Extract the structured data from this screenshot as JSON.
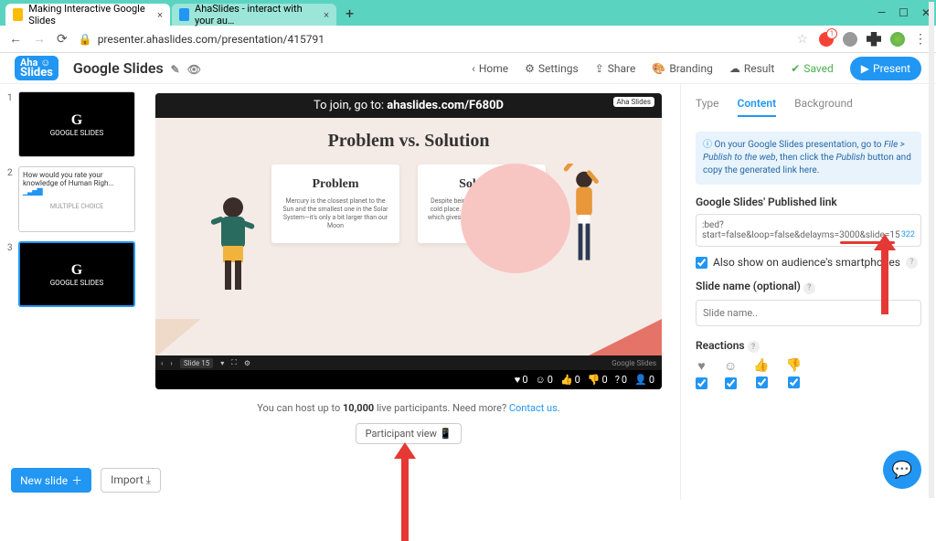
{
  "browser": {
    "tabs": [
      {
        "title": "Making Interactive Google Slides"
      },
      {
        "title": "AhaSlides - interact with your au…"
      }
    ],
    "url": "presenter.ahaslides.com/presentation/415791"
  },
  "app": {
    "logo_top": "Aha ☺",
    "logo_bot": "Slides",
    "doc_title": "Google Slides",
    "nav": {
      "home": "Home",
      "settings": "Settings",
      "share": "Share",
      "branding": "Branding",
      "result": "Result",
      "saved": "Saved",
      "present": "Present"
    }
  },
  "thumbs": [
    {
      "n": "1",
      "kind": "black",
      "line1": "G",
      "line2": "GOOGLE SLIDES"
    },
    {
      "n": "2",
      "kind": "white",
      "q": "How would you rate your knowledge of Human Righ...",
      "type": "MULTIPLE CHOICE"
    },
    {
      "n": "3",
      "kind": "black",
      "line1": "G",
      "line2": "GOOGLE SLIDES"
    }
  ],
  "slide": {
    "join_prefix": "To join, go to: ",
    "join_url": "ahaslides.com/F680D",
    "aha_badge": "Aha Slides",
    "title": "Problem vs. Solution",
    "problem_h": "Problem",
    "problem_p": "Mercury is the closest planet to the Sun and the smallest one in the Solar System—it's only a bit larger than our Moon",
    "solution_h": "Solution",
    "solution_p": "Despite being red, Mars is actually a cold place. It's full of iron oxide dust, which gives the planet its reddish cast",
    "ctrl_slide": "Slide 15",
    "gslides": "Google Slides",
    "reactions": {
      "heart": "0",
      "smile": "0",
      "like": "0",
      "dislike": "0",
      "q": "0",
      "people": "0"
    }
  },
  "host": {
    "note_a": "You can host up to ",
    "note_b": "10,000",
    "note_c": " live participants. Need more? ",
    "note_link": "Contact us",
    "pview": "Participant view"
  },
  "panel": {
    "tabs": {
      "type": "Type",
      "content": "Content",
      "background": "Background"
    },
    "info": {
      "a": "On your Google Slides presentation, go to ",
      "b": "File > Publish to the web",
      "c": ", then click the ",
      "d": "Publish",
      "e": " button and copy the generated link here."
    },
    "link_label": "Google Slides' Published link",
    "link_value": ":bed?start=false&loop=false&delayms=3000&slide=15",
    "link_count": "322",
    "also_show": "Also show on audience's smartphones",
    "name_label": "Slide name (optional)",
    "name_ph": "Slide name..",
    "reactions_label": "Reactions"
  },
  "bottom": {
    "new": "New slide",
    "import": "Import"
  }
}
